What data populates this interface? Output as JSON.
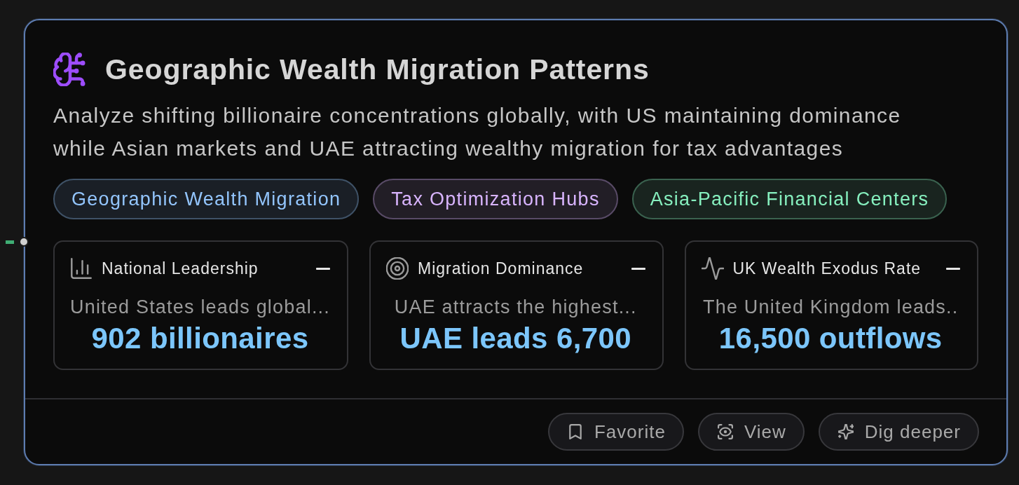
{
  "card": {
    "title": "Geographic Wealth Migration Patterns",
    "description": "Analyze shifting billionaire concentrations globally, with US maintaining dominance while Asian markets and UAE attracting wealthy migration for tax advantages"
  },
  "tags": [
    {
      "label": "Geographic Wealth Migration",
      "color": "#93c5fd"
    },
    {
      "label": "Tax Optimization Hubs",
      "color": "#d8b4fe"
    },
    {
      "label": "Asia-Pacific Financial Centers",
      "color": "#86efbe"
    }
  ],
  "metrics": [
    {
      "label": "National Leadership",
      "summary": "United States leads global...",
      "value": "902 billionaires"
    },
    {
      "label": "Migration Dominance",
      "summary": "UAE attracts the highest...",
      "value": "UAE leads 6,700"
    },
    {
      "label": "UK Wealth Exodus Rate",
      "summary": "The United Kingdom leads..",
      "value": "16,500 outflows"
    }
  ],
  "actions": [
    {
      "label": "Favorite"
    },
    {
      "label": "View"
    },
    {
      "label": "Dig deeper"
    }
  ]
}
